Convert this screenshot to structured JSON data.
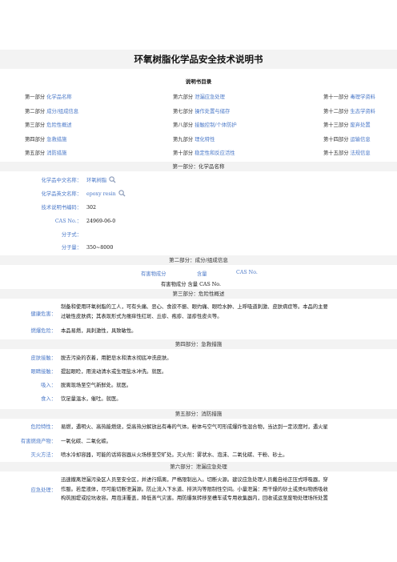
{
  "title": "环氧树脂化学品安全技术说明书",
  "toc_title": "说明书目录",
  "toc": [
    [
      {
        "num": "第一部分",
        "label": "化学品名称"
      },
      {
        "num": "第六部分",
        "label": "泄漏应急处理"
      },
      {
        "num": "第十一部分",
        "label": "毒理学资料"
      }
    ],
    [
      {
        "num": "第二部分",
        "label": "成分/组成信息"
      },
      {
        "num": "第七部分",
        "label": "操作处置与储存"
      },
      {
        "num": "第十二部分",
        "label": "生态学资料"
      }
    ],
    [
      {
        "num": "第三部分",
        "label": "危险性概述"
      },
      {
        "num": "第八部分",
        "label": "接触控制/个体防护"
      },
      {
        "num": "第十三部分",
        "label": "废弃处置"
      }
    ],
    [
      {
        "num": "第四部分",
        "label": "急救措施"
      },
      {
        "num": "第九部分",
        "label": "理化特性"
      },
      {
        "num": "第十四部分",
        "label": "运输信息"
      }
    ],
    [
      {
        "num": "第五部分",
        "label": "消防措施"
      },
      {
        "num": "第十部分",
        "label": "稳定性和反应活性"
      },
      {
        "num": "第十五部分",
        "label": "法规信息"
      }
    ]
  ],
  "sec1": {
    "title": "第一部分：化学品名称",
    "cn_name_label": "化学品中文名称：",
    "cn_name": "环氧树脂",
    "en_name_label": "化学品英文名称：",
    "en_name": "epoxy resin",
    "code_label": "技术说明书编码：",
    "code": "302",
    "cas_label": "CAS No.：",
    "cas": "24969-06-0",
    "formula_label": "分子式：",
    "formula": "",
    "mw_label": "分子量：",
    "mw": "350~8000"
  },
  "sec2": {
    "title": "第二部分：成分/组成信息",
    "header_hazard": "有害物成分",
    "header_content": "含量",
    "header_cas": "CAS No.",
    "line": "有害物成分 含量 CAS No."
  },
  "sec3": {
    "title": "第三部分：危险性概述",
    "health_label": "健康危害：",
    "health_1": "制备和使用环氧树脂的工人，可有头痛、恶心、食欲不振、眼灼痛、眼睑水肿、上呼吸道刺激、皮肤病症等。本品的主要",
    "health_2": "过敏性皮肤病；其表现形式为瘙痒性红斑、丘疹、疱疹、湿疹性皮炎等。",
    "fire_label": "燃爆危险：",
    "fire": "本品易燃，具刺激性，具致敏性。"
  },
  "sec4": {
    "title": "第四部分：急救措施",
    "skin_label": "皮肤接触：",
    "skin": "脱去污染的衣着，用肥皂水和清水彻底冲洗皮肤。",
    "eye_label": "眼睛接触：",
    "eye": "提起眼睑，用流动清水或生理盐水冲洗。就医。",
    "inhale_label": "吸入：",
    "inhale": "脱离现场至空气新鲜处。就医。",
    "ingest_label": "食入：",
    "ingest": "饮足量温水，催吐。就医。"
  },
  "sec5": {
    "title": "第五部分：消防措施",
    "hazard_label": "危险特性：",
    "hazard": "易燃，遇明火、高热能燃烧，受高热分解放出有毒的气体。粉体与空气可形成爆炸性混合物，当达到一定浓度时，遇火星",
    "products_label": "有害燃烧产物：",
    "products": "一氧化碳、二氧化碳。",
    "method_label": "灭火方法：",
    "method": "喷水冷却容器，可能的话将容器从火场移至空旷处。灭火剂：雾状水、泡沫、二氧化碳、干粉、砂土。"
  },
  "sec6": {
    "title": "第六部分：泄漏应急处理",
    "label": "应急处理：",
    "line_1": "迅速撤离泄漏污染区人员至安全区，并进行隔离，严格限制出入。切断火源。建议应急处理人员戴自给正压式呼吸器，穿",
    "line_2": "作服。若是液体，尽可能切断泄漏源。防止流入下水道、排洪沟等限制性空间。小量泄漏：用干燥的砂土或类似物质吸收",
    "line_3": "构筑围堤或挖坑收容。用泡沫覆盖，降低蒸气灾害。用防爆泵转移至槽车或专用收集器内，回收或运至废物处理场所处置"
  },
  "colors": {
    "link": "#4a78c8",
    "band": "#f3f3f3",
    "text": "#111111"
  },
  "icons": {
    "search": "magnifier-icon"
  }
}
